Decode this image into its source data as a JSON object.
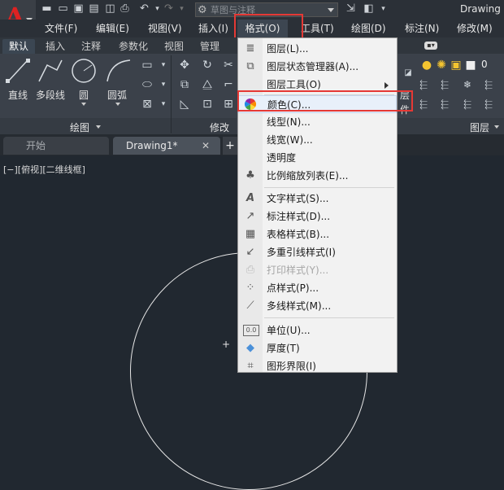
{
  "app": {
    "logo_letter": "A",
    "title": "Drawing",
    "workspace": "草图与注释"
  },
  "menubar": {
    "items": [
      "文件(F)",
      "编辑(E)",
      "视图(V)",
      "插入(I)",
      "格式(O)",
      "工具(T)",
      "绘图(D)",
      "标注(N)",
      "修改(M)"
    ]
  },
  "ribbon": {
    "tabs": [
      "默认",
      "插入",
      "注释",
      "参数化",
      "视图",
      "管理"
    ],
    "draw": {
      "line": "直线",
      "polyline": "多段线",
      "circle": "圆",
      "arc": "圆弧",
      "title": "绘图"
    },
    "modify_title": "修改",
    "layers": {
      "title": "图层",
      "current_layer": "0",
      "layer_tail": "层",
      "layer_tail2": "件"
    }
  },
  "doc_tabs": {
    "start": "开始",
    "drawing": "Drawing1*",
    "close_glyph": "✕",
    "add_glyph": "+"
  },
  "canvas": {
    "view_label": "[−][俯视][二维线框]"
  },
  "format_menu": {
    "items": [
      {
        "label": "图层(L)...",
        "icon": "layer-icon",
        "glyph": "≣"
      },
      {
        "label": "图层状态管理器(A)...",
        "icon": "layer-state-icon",
        "glyph": "⧉"
      },
      {
        "label": "图层工具(O)",
        "icon": "",
        "glyph": "",
        "submenu": true
      },
      {
        "label": "颜色(C)...",
        "icon": "color-wheel-icon",
        "glyph": "",
        "highlighted": true
      },
      {
        "label": "线型(N)...",
        "icon": "",
        "glyph": ""
      },
      {
        "label": "线宽(W)...",
        "icon": "",
        "glyph": ""
      },
      {
        "label": "透明度",
        "icon": "",
        "glyph": ""
      },
      {
        "label": "比例缩放列表(E)...",
        "icon": "scale-list-icon",
        "glyph": "♣"
      },
      {
        "label": "文字样式(S)...",
        "icon": "text-style-icon",
        "glyph": "A"
      },
      {
        "label": "标注样式(D)...",
        "icon": "dim-style-icon",
        "glyph": "↗"
      },
      {
        "label": "表格样式(B)...",
        "icon": "table-style-icon",
        "glyph": "▦"
      },
      {
        "label": "多重引线样式(I)",
        "icon": "mleader-style-icon",
        "glyph": "↙"
      },
      {
        "label": "打印样式(Y)...",
        "icon": "plot-style-icon",
        "glyph": "⎙",
        "disabled": true
      },
      {
        "label": "点样式(P)...",
        "icon": "point-style-icon",
        "glyph": "⁘"
      },
      {
        "label": "多线样式(M)...",
        "icon": "mline-style-icon",
        "glyph": "⟋"
      },
      {
        "label": "单位(U)...",
        "icon": "units-icon",
        "glyph": "0.0"
      },
      {
        "label": "厚度(T)",
        "icon": "thickness-icon",
        "glyph": "◆"
      },
      {
        "label": "图形界限(I)",
        "icon": "limits-icon",
        "glyph": "⌗"
      }
    ]
  },
  "colors": {
    "highlight": "#e53935",
    "background": "#212830",
    "ribbon": "#3b414a"
  }
}
